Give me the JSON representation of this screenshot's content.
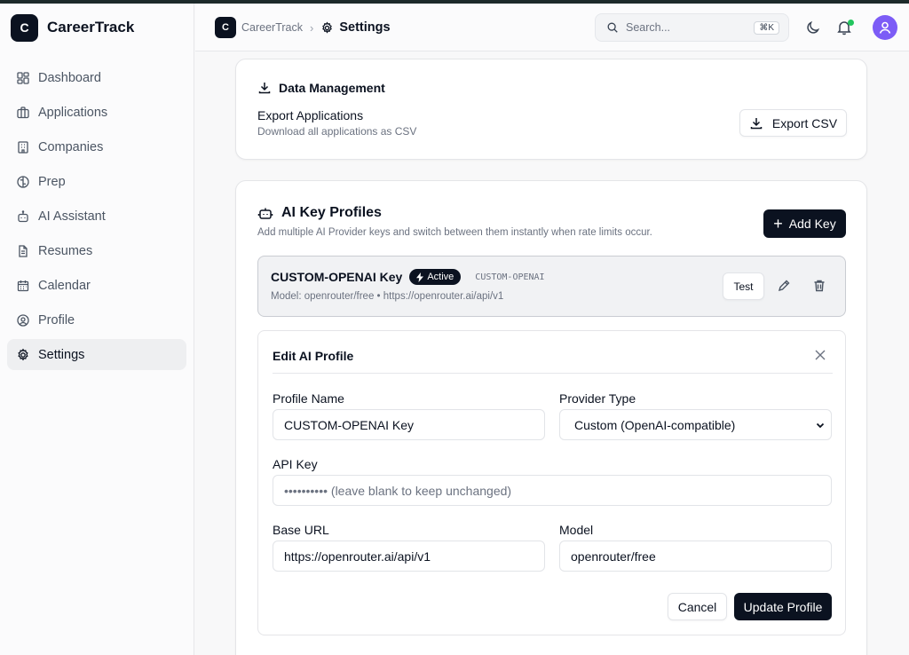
{
  "app": {
    "logo_letter": "C",
    "name": "CareerTrack"
  },
  "sidebar": {
    "items": [
      {
        "label": "Dashboard",
        "icon": "dashboard-icon"
      },
      {
        "label": "Applications",
        "icon": "briefcase-icon"
      },
      {
        "label": "Companies",
        "icon": "building-icon"
      },
      {
        "label": "Prep",
        "icon": "brain-icon"
      },
      {
        "label": "AI Assistant",
        "icon": "bot-icon"
      },
      {
        "label": "Resumes",
        "icon": "file-icon"
      },
      {
        "label": "Calendar",
        "icon": "calendar-icon"
      },
      {
        "label": "Profile",
        "icon": "user-circle-icon"
      },
      {
        "label": "Settings",
        "icon": "gear-icon",
        "active": true
      }
    ]
  },
  "header": {
    "breadcrumb_app": "CareerTrack",
    "breadcrumb_sep": "›",
    "page_title": "Settings",
    "search_placeholder": "Search...",
    "search_shortcut": "⌘K"
  },
  "data_management": {
    "title": "Data Management",
    "export_title": "Export Applications",
    "export_desc": "Download all applications as CSV",
    "export_button": "Export CSV"
  },
  "ai_profiles": {
    "title": "AI Key Profiles",
    "description": "Add multiple AI Provider keys and switch between them instantly when rate limits occur.",
    "add_button": "Add Key",
    "profile": {
      "name": "CUSTOM-OPENAI Key",
      "badge": "Active",
      "provider_tag": "CUSTOM-OPENAI",
      "meta": "Model: openrouter/free • https://openrouter.ai/api/v1",
      "test_button": "Test"
    },
    "edit": {
      "title": "Edit AI Profile",
      "profile_name_label": "Profile Name",
      "profile_name_value": "CUSTOM-OPENAI Key",
      "provider_type_label": "Provider Type",
      "provider_type_value": "Custom (OpenAI-compatible)",
      "api_key_label": "API Key",
      "api_key_placeholder": "•••••••••• (leave blank to keep unchanged)",
      "base_url_label": "Base URL",
      "base_url_value": "https://openrouter.ai/api/v1",
      "model_label": "Model",
      "model_value": "openrouter/free",
      "cancel_button": "Cancel",
      "update_button": "Update Profile"
    }
  },
  "colors": {
    "primary": "#0b1220",
    "accent_avatar": "#7c5cf6",
    "notification": "#22c55e"
  }
}
